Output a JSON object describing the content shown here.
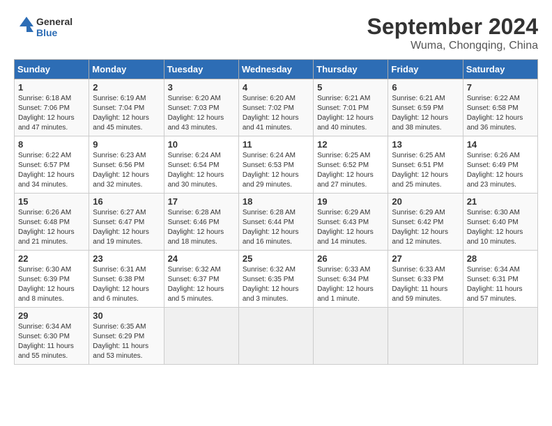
{
  "header": {
    "logo_line1": "General",
    "logo_line2": "Blue",
    "month_title": "September 2024",
    "subtitle": "Wuma, Chongqing, China"
  },
  "days_of_week": [
    "Sunday",
    "Monday",
    "Tuesday",
    "Wednesday",
    "Thursday",
    "Friday",
    "Saturday"
  ],
  "weeks": [
    [
      {
        "day": "1",
        "detail": "Sunrise: 6:18 AM\nSunset: 7:06 PM\nDaylight: 12 hours\nand 47 minutes."
      },
      {
        "day": "2",
        "detail": "Sunrise: 6:19 AM\nSunset: 7:04 PM\nDaylight: 12 hours\nand 45 minutes."
      },
      {
        "day": "3",
        "detail": "Sunrise: 6:20 AM\nSunset: 7:03 PM\nDaylight: 12 hours\nand 43 minutes."
      },
      {
        "day": "4",
        "detail": "Sunrise: 6:20 AM\nSunset: 7:02 PM\nDaylight: 12 hours\nand 41 minutes."
      },
      {
        "day": "5",
        "detail": "Sunrise: 6:21 AM\nSunset: 7:01 PM\nDaylight: 12 hours\nand 40 minutes."
      },
      {
        "day": "6",
        "detail": "Sunrise: 6:21 AM\nSunset: 6:59 PM\nDaylight: 12 hours\nand 38 minutes."
      },
      {
        "day": "7",
        "detail": "Sunrise: 6:22 AM\nSunset: 6:58 PM\nDaylight: 12 hours\nand 36 minutes."
      }
    ],
    [
      {
        "day": "8",
        "detail": "Sunrise: 6:22 AM\nSunset: 6:57 PM\nDaylight: 12 hours\nand 34 minutes."
      },
      {
        "day": "9",
        "detail": "Sunrise: 6:23 AM\nSunset: 6:56 PM\nDaylight: 12 hours\nand 32 minutes."
      },
      {
        "day": "10",
        "detail": "Sunrise: 6:24 AM\nSunset: 6:54 PM\nDaylight: 12 hours\nand 30 minutes."
      },
      {
        "day": "11",
        "detail": "Sunrise: 6:24 AM\nSunset: 6:53 PM\nDaylight: 12 hours\nand 29 minutes."
      },
      {
        "day": "12",
        "detail": "Sunrise: 6:25 AM\nSunset: 6:52 PM\nDaylight: 12 hours\nand 27 minutes."
      },
      {
        "day": "13",
        "detail": "Sunrise: 6:25 AM\nSunset: 6:51 PM\nDaylight: 12 hours\nand 25 minutes."
      },
      {
        "day": "14",
        "detail": "Sunrise: 6:26 AM\nSunset: 6:49 PM\nDaylight: 12 hours\nand 23 minutes."
      }
    ],
    [
      {
        "day": "15",
        "detail": "Sunrise: 6:26 AM\nSunset: 6:48 PM\nDaylight: 12 hours\nand 21 minutes."
      },
      {
        "day": "16",
        "detail": "Sunrise: 6:27 AM\nSunset: 6:47 PM\nDaylight: 12 hours\nand 19 minutes."
      },
      {
        "day": "17",
        "detail": "Sunrise: 6:28 AM\nSunset: 6:46 PM\nDaylight: 12 hours\nand 18 minutes."
      },
      {
        "day": "18",
        "detail": "Sunrise: 6:28 AM\nSunset: 6:44 PM\nDaylight: 12 hours\nand 16 minutes."
      },
      {
        "day": "19",
        "detail": "Sunrise: 6:29 AM\nSunset: 6:43 PM\nDaylight: 12 hours\nand 14 minutes."
      },
      {
        "day": "20",
        "detail": "Sunrise: 6:29 AM\nSunset: 6:42 PM\nDaylight: 12 hours\nand 12 minutes."
      },
      {
        "day": "21",
        "detail": "Sunrise: 6:30 AM\nSunset: 6:40 PM\nDaylight: 12 hours\nand 10 minutes."
      }
    ],
    [
      {
        "day": "22",
        "detail": "Sunrise: 6:30 AM\nSunset: 6:39 PM\nDaylight: 12 hours\nand 8 minutes."
      },
      {
        "day": "23",
        "detail": "Sunrise: 6:31 AM\nSunset: 6:38 PM\nDaylight: 12 hours\nand 6 minutes."
      },
      {
        "day": "24",
        "detail": "Sunrise: 6:32 AM\nSunset: 6:37 PM\nDaylight: 12 hours\nand 5 minutes."
      },
      {
        "day": "25",
        "detail": "Sunrise: 6:32 AM\nSunset: 6:35 PM\nDaylight: 12 hours\nand 3 minutes."
      },
      {
        "day": "26",
        "detail": "Sunrise: 6:33 AM\nSunset: 6:34 PM\nDaylight: 12 hours\nand 1 minute."
      },
      {
        "day": "27",
        "detail": "Sunrise: 6:33 AM\nSunset: 6:33 PM\nDaylight: 11 hours\nand 59 minutes."
      },
      {
        "day": "28",
        "detail": "Sunrise: 6:34 AM\nSunset: 6:31 PM\nDaylight: 11 hours\nand 57 minutes."
      }
    ],
    [
      {
        "day": "29",
        "detail": "Sunrise: 6:34 AM\nSunset: 6:30 PM\nDaylight: 11 hours\nand 55 minutes."
      },
      {
        "day": "30",
        "detail": "Sunrise: 6:35 AM\nSunset: 6:29 PM\nDaylight: 11 hours\nand 53 minutes."
      },
      {
        "day": "",
        "detail": ""
      },
      {
        "day": "",
        "detail": ""
      },
      {
        "day": "",
        "detail": ""
      },
      {
        "day": "",
        "detail": ""
      },
      {
        "day": "",
        "detail": ""
      }
    ]
  ]
}
